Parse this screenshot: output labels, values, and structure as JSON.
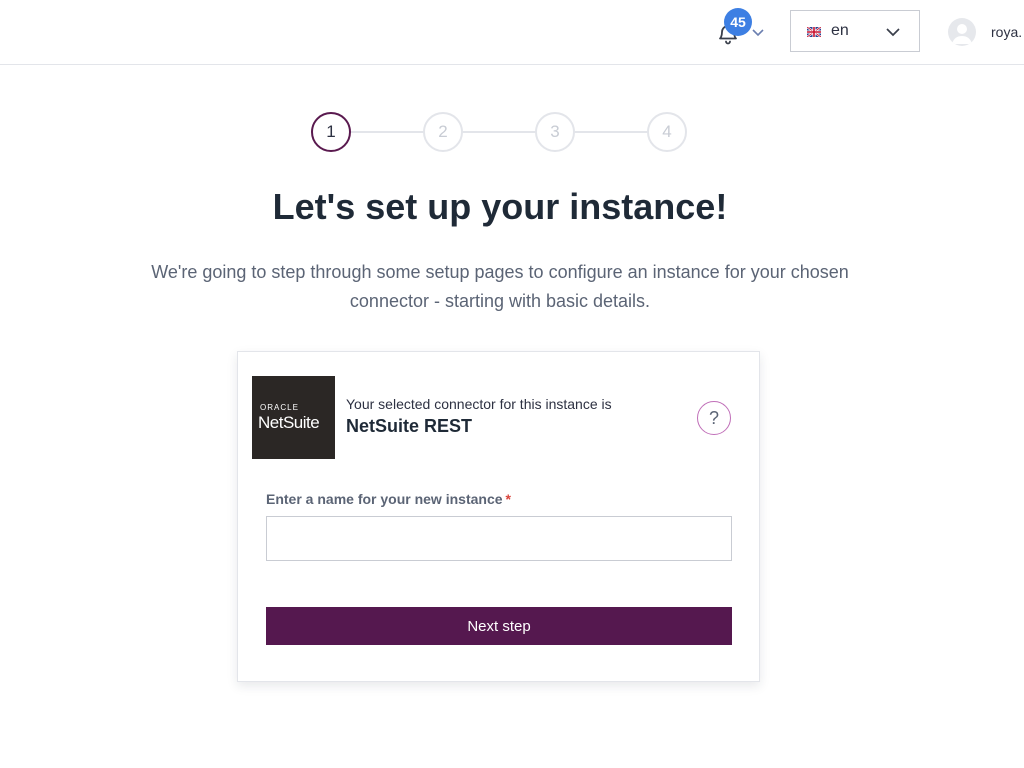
{
  "header": {
    "notifications": {
      "count": "45",
      "icon": "bell-icon"
    },
    "language": {
      "flag": "uk-flag",
      "selected": "en"
    },
    "user": {
      "name": "roya."
    }
  },
  "stepper": {
    "steps": [
      "1",
      "2",
      "3",
      "4"
    ],
    "active_step": 1
  },
  "main": {
    "title": "Let's set up your instance!",
    "subtitle": "We're going to step through some setup pages to configure an instance for your chosen connector - starting with basic details."
  },
  "card": {
    "logo": {
      "brand_small": "ORACLE",
      "brand_large": "NetSuite"
    },
    "connector_label": "Your selected connector for this instance is",
    "connector_name": "NetSuite REST",
    "help_symbol": "?",
    "name_field": {
      "label": "Enter a name for your new instance",
      "required_mark": "*",
      "value": "",
      "placeholder": ""
    },
    "next_button": "Next step"
  },
  "colors": {
    "primary": "#55184f",
    "badge": "#3d7fe3",
    "required": "#d9443c"
  }
}
